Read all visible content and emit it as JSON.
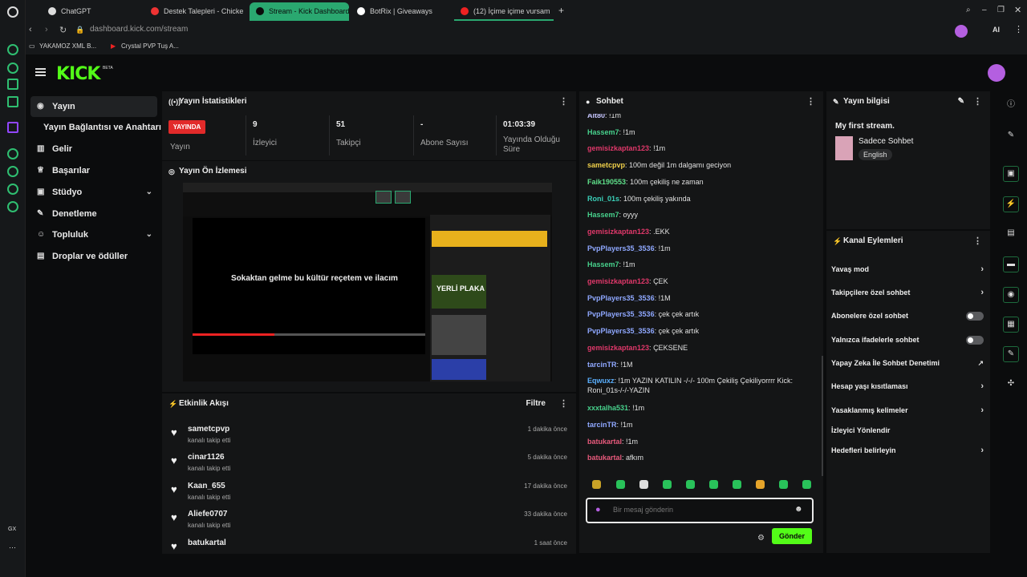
{
  "browser": {
    "tabs": [
      {
        "label": "ChatGPT",
        "active": false
      },
      {
        "label": "Destek Talepleri - Chicken",
        "active": false
      },
      {
        "label": "Stream - Kick Dashboard",
        "active": true
      },
      {
        "label": "BotRix | Giveaways",
        "active": false
      },
      {
        "label": "(12) İçime içime vursam",
        "active": false
      }
    ],
    "url": "dashboard.kick.com/stream",
    "bookmarks": [
      "YAKAMOZ XML B...",
      "Crystal PVP Tuş A..."
    ],
    "side_label": "GX"
  },
  "header": {
    "logo": "KICK",
    "beta": "BETA"
  },
  "nav": {
    "items": [
      {
        "label": "Yayın",
        "icon": "broadcast-icon"
      },
      {
        "label": "Yayın Bağlantısı ve Anahtarı",
        "icon": ""
      },
      {
        "label": "Gelir",
        "icon": "chart-icon"
      },
      {
        "label": "Başarılar",
        "icon": "trophy-icon"
      },
      {
        "label": "Stüdyo",
        "icon": "studio-icon"
      },
      {
        "label": "Denetleme",
        "icon": "wrench-icon"
      },
      {
        "label": "Topluluk",
        "icon": "community-icon"
      },
      {
        "label": "Droplar ve ödüller",
        "icon": "gift-icon"
      }
    ]
  },
  "stats": {
    "title": "Yayın İstatistikleri",
    "live_badge": "YAYINDA",
    "live_label": "Yayın",
    "items": [
      {
        "value": "9",
        "label": "İzleyici"
      },
      {
        "value": "51",
        "label": "Takipçi"
      },
      {
        "value": "-",
        "label": "Abone Sayısı"
      },
      {
        "value": "01:03:39",
        "label": "Yayında Olduğu Süre"
      }
    ]
  },
  "preview": {
    "title": "Yayın Ön İzlemesi",
    "caption": "Sokaktan gelme bu kültür reçetem ve ilacım",
    "thumb_label": "YERLİ PLAKA"
  },
  "activity": {
    "title": "Etkinlik Akışı",
    "filter": "Filtre",
    "items": [
      {
        "name": "sametcpvp",
        "sub": "kanalı takip etti",
        "time": "1 dakika önce"
      },
      {
        "name": "cinar1126",
        "sub": "kanalı takip etti",
        "time": "5 dakika önce"
      },
      {
        "name": "Kaan_655",
        "sub": "kanalı takip etti",
        "time": "17 dakika önce"
      },
      {
        "name": "Aliefe0707",
        "sub": "kanalı takip etti",
        "time": "33 dakika önce"
      },
      {
        "name": "batukartal",
        "sub": "",
        "time": "1 saat önce"
      }
    ]
  },
  "chat": {
    "title": "Sohbet",
    "messages": [
      {
        "user": "Ait80",
        "text": "!1m",
        "color": "#c6c6ff"
      },
      {
        "user": "Hassem7",
        "text": "!1m",
        "color": "#47d18c"
      },
      {
        "user": "gemisizkaptan123",
        "text": "!1m",
        "color": "#e0386a"
      },
      {
        "user": "sametcpvp",
        "text": "100m değil 1m dalgamı geciyon",
        "color": "#f0d04a"
      },
      {
        "user": "Faik190553",
        "text": "100m çekiliş ne zaman",
        "color": "#5fe08a"
      },
      {
        "user": "Roni_01s",
        "text": "100m çekiliş yakında",
        "color": "#3ad0b8"
      },
      {
        "user": "Hassem7",
        "text": "oyyy",
        "color": "#47d18c"
      },
      {
        "user": "gemisizkaptan123",
        "text": ".EKK",
        "color": "#e0386a"
      },
      {
        "user": "PvpPlayers35_3536",
        "text": "!1m",
        "color": "#8fa8ff"
      },
      {
        "user": "Hassem7",
        "text": "!1m",
        "color": "#47d18c"
      },
      {
        "user": "gemisizkaptan123",
        "text": "ÇEK",
        "color": "#e0386a"
      },
      {
        "user": "PvpPlayers35_3536",
        "text": "!1M",
        "color": "#8fa8ff"
      },
      {
        "user": "PvpPlayers35_3536",
        "text": "çek çek artık",
        "color": "#8fa8ff"
      },
      {
        "user": "PvpPlayers35_3536",
        "text": "çek çek artık",
        "color": "#8fa8ff"
      },
      {
        "user": "gemisizkaptan123",
        "text": "ÇEKSENE",
        "color": "#e0386a"
      },
      {
        "user": "tarcinTR",
        "text": "!1M",
        "color": "#8fa8ff"
      },
      {
        "user": "Eqwuxz",
        "text": "!1m YAZIN KATILIN -/-/- 100m Çekiliş Çekiliyorrrr Kick: Roni_01s-/-/-YAZIN",
        "color": "#5ab0ff"
      },
      {
        "user": "xxxtalha531",
        "text": "!1m",
        "color": "#47d18c"
      },
      {
        "user": "tarcinTR",
        "text": "!1m",
        "color": "#8fa8ff"
      },
      {
        "user": "batukartal",
        "text": "!1m",
        "color": "#e85a7c"
      },
      {
        "user": "batukartal",
        "text": "afkım",
        "color": "#e85a7c"
      }
    ],
    "input_placeholder": "Bir mesaj gönderin",
    "send_label": "Gönder"
  },
  "stream_info": {
    "title": "Yayın bilgisi",
    "stream_title": "My first stream.",
    "category": "Sadece Sohbet",
    "language": "English"
  },
  "channel_actions": {
    "title": "Kanal Eylemleri",
    "items": [
      {
        "label": "Yavaş mod",
        "kind": "chevron"
      },
      {
        "label": "Takipçilere özel sohbet",
        "kind": "chevron"
      },
      {
        "label": "Abonelere özel sohbet",
        "kind": "toggle"
      },
      {
        "label": "Yalnızca ifadelerle sohbet",
        "kind": "toggle"
      },
      {
        "label": "Yapay Zeka İle Sohbet Denetimi",
        "kind": "external"
      },
      {
        "label": "Hesap yaşı kısıtlaması",
        "kind": "chevron"
      },
      {
        "label": "Yasaklanmış kelimeler",
        "kind": "chevron"
      },
      {
        "label": "İzleyici Yönlendir",
        "kind": "none"
      },
      {
        "label": "Hedefleri belirleyin",
        "kind": "chevron"
      }
    ]
  },
  "colors": {
    "accent": "#53fc18",
    "live": "#e22a2a",
    "browser_active_tab": "#2aa870"
  }
}
